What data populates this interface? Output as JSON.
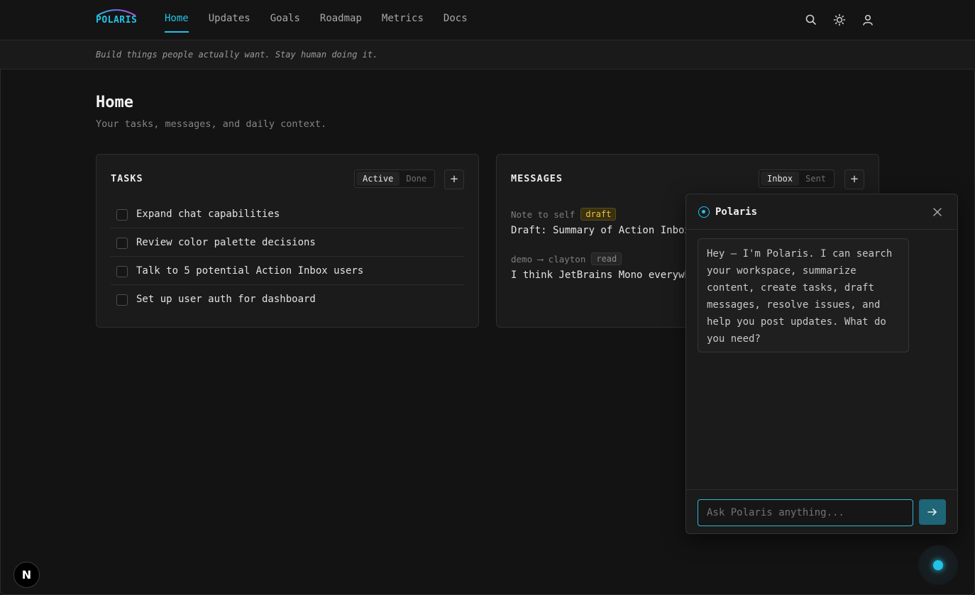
{
  "brand": {
    "name": "POLARIS",
    "accent": "#22c3e6"
  },
  "nav": {
    "items": [
      {
        "label": "Home",
        "active": true
      },
      {
        "label": "Updates",
        "active": false
      },
      {
        "label": "Goals",
        "active": false
      },
      {
        "label": "Roadmap",
        "active": false
      },
      {
        "label": "Metrics",
        "active": false
      },
      {
        "label": "Docs",
        "active": false
      }
    ],
    "icons": [
      "search-icon",
      "theme-sun-icon",
      "user-icon"
    ]
  },
  "tagline": "Build things people actually want. Stay human doing it.",
  "page": {
    "title": "Home",
    "subtitle": "Your tasks, messages, and daily context."
  },
  "tasks": {
    "title": "TASKS",
    "tabs": [
      "Active",
      "Done"
    ],
    "active_tab": "Active",
    "add_label": "+",
    "items": [
      {
        "text": "Expand chat capabilities",
        "checked": false
      },
      {
        "text": "Review color palette decisions",
        "checked": false
      },
      {
        "text": "Talk to 5 potential Action Inbox users",
        "checked": false
      },
      {
        "text": "Set up user auth for dashboard",
        "checked": false
      }
    ]
  },
  "messages": {
    "title": "MESSAGES",
    "tabs": [
      "Inbox",
      "Sent"
    ],
    "active_tab": "Inbox",
    "add_label": "+",
    "items": [
      {
        "meta": "Note to self",
        "badge": "draft",
        "body": "Draft: Summary of Action Inbox"
      },
      {
        "meta": "demo ⟶ clayton",
        "badge": "read",
        "body": "I think JetBrains Mono everywhere"
      }
    ]
  },
  "chat": {
    "name": "Polaris",
    "greeting": "Hey — I'm Polaris. I can search your workspace, summarize content, create tasks, draft messages, resolve issues, and help you post updates. What do you need?",
    "input_placeholder": "Ask Polaris anything...",
    "input_value": ""
  },
  "floating": {
    "badge_letter": "N"
  }
}
